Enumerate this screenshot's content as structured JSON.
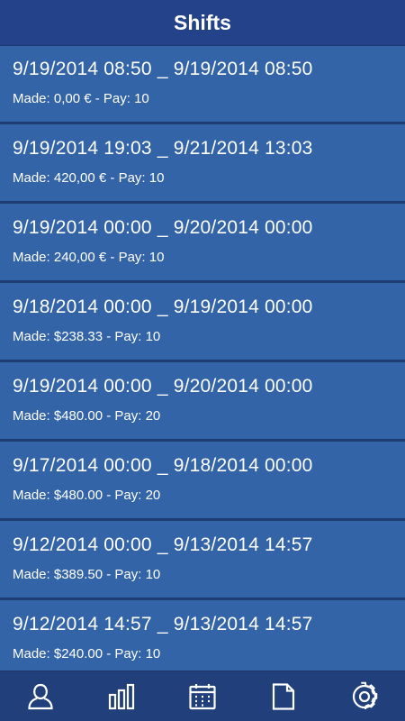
{
  "header": {
    "title": "Shifts"
  },
  "shifts": [
    {
      "range": "9/19/2014 08:50 _ 9/19/2014 08:50",
      "meta": "Made: 0,00 € - Pay: 10"
    },
    {
      "range": "9/19/2014 19:03 _ 9/21/2014 13:03",
      "meta": "Made: 420,00 € - Pay: 10"
    },
    {
      "range": "9/19/2014 00:00 _ 9/20/2014 00:00",
      "meta": "Made: 240,00 € - Pay: 10"
    },
    {
      "range": "9/18/2014 00:00 _ 9/19/2014 00:00",
      "meta": "Made: $238.33 - Pay: 10"
    },
    {
      "range": "9/19/2014 00:00 _ 9/20/2014 00:00",
      "meta": "Made: $480.00 - Pay: 20"
    },
    {
      "range": "9/17/2014 00:00 _ 9/18/2014 00:00",
      "meta": "Made: $480.00 - Pay: 20"
    },
    {
      "range": "9/12/2014 00:00 _ 9/13/2014 14:57",
      "meta": "Made: $389.50 - Pay: 10"
    },
    {
      "range": "9/12/2014 14:57 _ 9/13/2014 14:57",
      "meta": "Made: $240.00 - Pay: 10"
    }
  ],
  "bottom_nav": {
    "items": [
      {
        "icon": "user-icon"
      },
      {
        "icon": "bar-chart-icon"
      },
      {
        "icon": "calendar-icon"
      },
      {
        "icon": "document-icon"
      },
      {
        "icon": "gear-icon"
      }
    ]
  },
  "colors": {
    "header_bg": "#24428a",
    "item_bg": "#3364a7",
    "divider": "#1f3d73",
    "nav_bg": "#213f7b",
    "text": "#ffffff"
  }
}
